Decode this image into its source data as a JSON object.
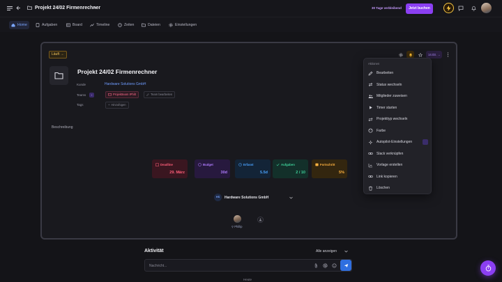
{
  "topbar": {
    "title": "Projekt 24/02 Firmenrechner",
    "trial_text": "30 Tage verbleibend",
    "book_label": "Jetzt buchen"
  },
  "tabs": [
    {
      "label": "Home",
      "icon": "home-icon",
      "active": true
    },
    {
      "label": "Aufgaben",
      "icon": "task-icon"
    },
    {
      "label": "Board",
      "icon": "board-icon"
    },
    {
      "label": "Timeline",
      "icon": "timeline-icon"
    },
    {
      "label": "Zeiten",
      "icon": "clock-icon"
    },
    {
      "label": "Dateien",
      "icon": "folder-icon"
    },
    {
      "label": "Einstellungen",
      "icon": "gear-icon"
    }
  ],
  "project": {
    "status": "Läuft",
    "title": "Projekt 24/02 Firmenrechner",
    "kunde_label": "Kunde",
    "kunde_value": "Hardware Solutions GmbH",
    "teams_label": "Teams",
    "team_badge": "+",
    "team_chip": "Projektteam IPhilt",
    "team_edit": "Team bearbeiten",
    "tags_label": "Tags",
    "tags_add": "Hinzufügen",
    "description_label": "Beschreibung",
    "date_chip": "14.03."
  },
  "stats": [
    {
      "label": "Deadline",
      "value": "29. März",
      "color": "#ff5f7a",
      "bg": "#3a1620"
    },
    {
      "label": "Budget",
      "value": "30d",
      "color": "#b07cff",
      "bg": "#27193e"
    },
    {
      "label": "Erfasst",
      "value": "5.5d",
      "color": "#4aa3ff",
      "bg": "#132437"
    },
    {
      "label": "Aufgaben",
      "value": "2 / 10",
      "color": "#3fd29a",
      "bg": "#13302a"
    },
    {
      "label": "Fortschritt",
      "value": "5%",
      "color": "#ffb340",
      "bg": "#33260f"
    }
  ],
  "client": {
    "initials": "HS",
    "name": "Hardware Solutions GmbH"
  },
  "member": {
    "name": "Phillip"
  },
  "menu": {
    "header": "Aktionen",
    "items": [
      {
        "label": "Bearbeiten",
        "icon": "pencil-icon"
      },
      {
        "label": "Status wechseln",
        "icon": "status-icon"
      },
      {
        "label": "Mitglieder zuweisen",
        "icon": "users-icon"
      },
      {
        "label": "Timer starten",
        "icon": "play-icon"
      },
      {
        "label": "Projekttyp wechseln",
        "icon": "swap-icon"
      },
      {
        "label": "Farbe",
        "icon": "palette-icon"
      },
      {
        "label": "Autopilot-Einstellungen",
        "icon": "autopilot-icon"
      },
      {
        "label": "Slack verknüpfen",
        "icon": "link-icon"
      },
      {
        "label": "Vorlage erstellen",
        "icon": "template-icon"
      },
      {
        "label": "Link kopieren",
        "icon": "chain-icon"
      },
      {
        "label": "Löschen",
        "icon": "trash-icon"
      }
    ]
  },
  "activity": {
    "title": "Aktivität",
    "filter": "Alle anzeigen",
    "placeholder": "Nachricht...",
    "more": "Heute"
  }
}
